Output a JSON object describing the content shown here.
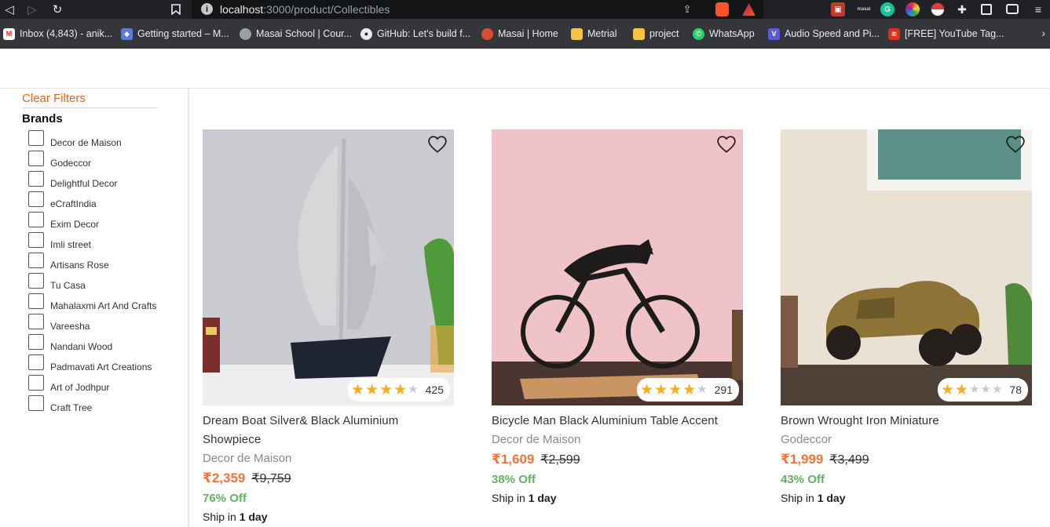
{
  "browser": {
    "url_host": "localhost",
    "url_rest": ":3000/product/Collectibles",
    "bookmarks": [
      {
        "label": "Inbox (4,843) - anik...",
        "icon": "gmail-icon",
        "color": "#d93025"
      },
      {
        "label": "Getting started – M...",
        "icon": "layers-icon",
        "color": "#5b7bd5"
      },
      {
        "label": "Masai School | Cour...",
        "icon": "globe-icon",
        "color": "#9aa0a6"
      },
      {
        "label": "GitHub: Let's build f...",
        "icon": "github-icon",
        "color": "#e8eaed"
      },
      {
        "label": "Masai | Home",
        "icon": "masai-icon",
        "color": "#d94c3a"
      },
      {
        "label": "Metrial",
        "icon": "folder-icon",
        "color": "#f4c542"
      },
      {
        "label": "project",
        "icon": "folder-icon",
        "color": "#f4c542"
      },
      {
        "label": "WhatsApp",
        "icon": "whatsapp-icon",
        "color": "#25d366"
      },
      {
        "label": "Audio Speed and Pi...",
        "icon": "v-icon",
        "color": "#5b5bd6"
      },
      {
        "label": "[FREE] YouTube Tag...",
        "icon": "youtube-tag-icon",
        "color": "#d93025"
      }
    ]
  },
  "sidebar": {
    "clear_filters": "Clear Filters",
    "brands_title": "Brands",
    "brands": [
      "Decor de Maison",
      "Godeccor",
      "Delightful Decor",
      "eCraftIndia",
      "Exim Decor",
      "Imli street",
      "Artisans Rose",
      "Tu Casa",
      "Mahalaxmi Art And Crafts",
      "Vareesha",
      "Nandani Wood",
      "Padmavati Art Creations",
      "Art of Jodhpur",
      "Craft Tree"
    ]
  },
  "products": [
    {
      "title": "Dream Boat Silver& Black Aluminium Showpiece",
      "brand": "Decor de Maison",
      "price": "₹2,359",
      "mrp": "₹9,759",
      "off": "76% Off",
      "ship_prefix": "Ship in ",
      "ship_days": "1 day",
      "rating": 4,
      "reviews": "425"
    },
    {
      "title": "Bicycle Man Black Aluminium Table Accent",
      "brand": "Decor de Maison",
      "price": "₹1,609",
      "mrp": "₹2,599",
      "off": "38% Off",
      "ship_prefix": "Ship in ",
      "ship_days": "1 day",
      "rating": 4,
      "reviews": "291"
    },
    {
      "title": "Brown Wrought Iron Miniature",
      "brand": "Godeccor",
      "price": "₹1,999",
      "mrp": "₹3,499",
      "off": "43% Off",
      "ship_prefix": "Ship in ",
      "ship_days": "1 day",
      "rating": 2,
      "reviews": "78"
    }
  ]
}
